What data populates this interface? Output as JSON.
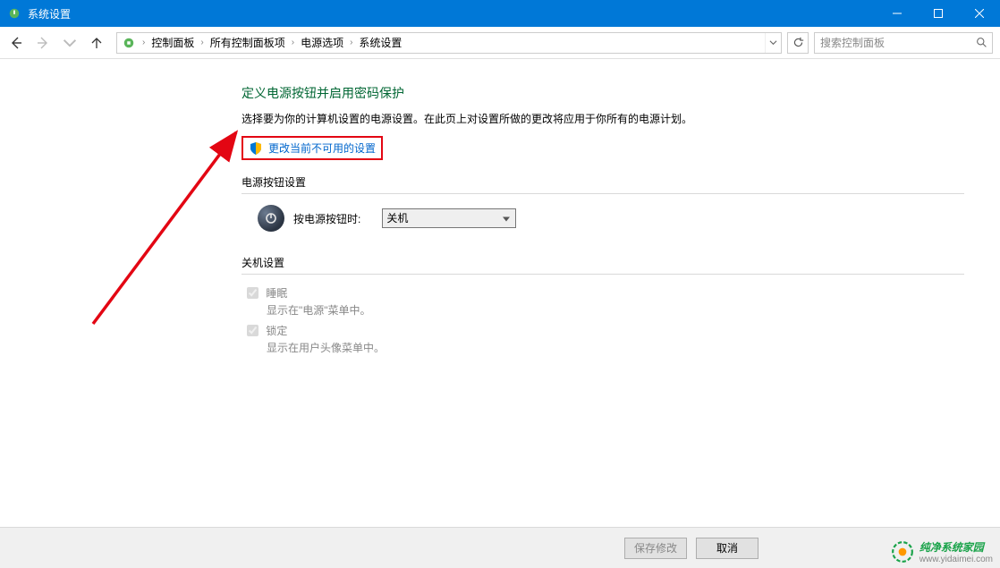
{
  "titlebar": {
    "title": "系统设置"
  },
  "breadcrumb": {
    "items": [
      "控制面板",
      "所有控制面板项",
      "电源选项",
      "系统设置"
    ]
  },
  "search": {
    "placeholder": "搜索控制面板"
  },
  "page": {
    "title": "定义电源按钮并启用密码保护",
    "desc": "选择要为你的计算机设置的电源设置。在此页上对设置所做的更改将应用于你所有的电源计划。",
    "change_link": "更改当前不可用的设置"
  },
  "sections": {
    "power_button": {
      "title": "电源按钮设置",
      "label": "按电源按钮时:",
      "selected": "关机"
    },
    "shutdown": {
      "title": "关机设置",
      "options": [
        {
          "label": "睡眠",
          "desc": "显示在\"电源\"菜单中。",
          "checked": true
        },
        {
          "label": "锁定",
          "desc": "显示在用户头像菜单中。",
          "checked": true
        }
      ]
    }
  },
  "footer": {
    "save": "保存修改",
    "cancel": "取消"
  },
  "watermark": {
    "text": "纯净系统家园",
    "sub": "www.yidaimei.com"
  }
}
